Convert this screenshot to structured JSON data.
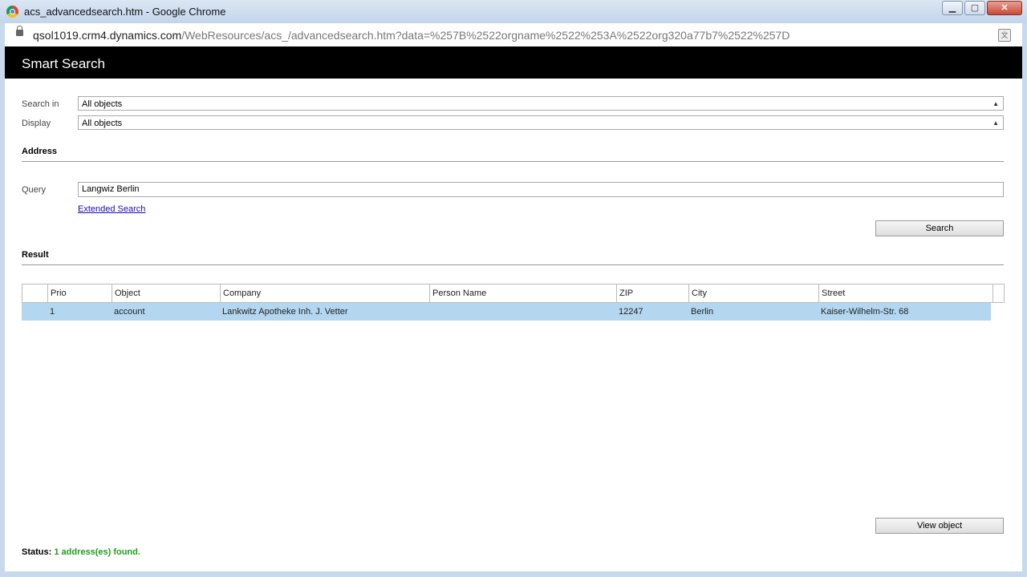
{
  "window": {
    "title": "acs_advancedsearch.htm - Google Chrome",
    "minimize": "▁",
    "maximize": "▢",
    "close": "✕"
  },
  "address_bar": {
    "host": "qsol1019.crm4.dynamics.com",
    "path": "/WebResources/acs_/advancedsearch.htm?data=%257B%2522orgname%2522%253A%2522org320a77b7%2522%257D"
  },
  "header": {
    "title": "Smart Search"
  },
  "filters": {
    "search_in_label": "Search in",
    "search_in_value": "All objects",
    "display_label": "Display",
    "display_value": "All objects"
  },
  "address_section": {
    "heading": "Address",
    "query_label": "Query",
    "query_value": "Langwiz Berlin",
    "extended_search_link": "Extended Search",
    "search_button": "Search"
  },
  "result_section": {
    "heading": "Result",
    "columns": [
      "Prio",
      "Object",
      "Company",
      "Person Name",
      "ZIP",
      "City",
      "Street"
    ],
    "rows": [
      {
        "prio": "1",
        "object": "account",
        "company": "Lankwitz Apotheke Inh. J. Vetter",
        "person_name": "",
        "zip": "12247",
        "city": "Berlin",
        "street": "Kaiser-Wilhelm-Str. 68"
      }
    ],
    "view_object_button": "View object"
  },
  "status": {
    "label": "Status:",
    "message": "1 address(es) found."
  },
  "colors": {
    "header_bg": "#000000",
    "selected_row": "#b3d7f1",
    "status_ok": "#1f9d1f",
    "link": "#1a0dab"
  }
}
